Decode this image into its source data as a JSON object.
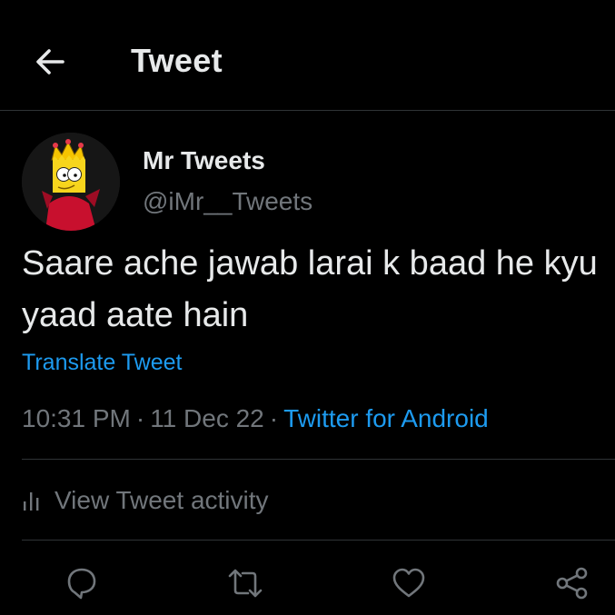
{
  "header": {
    "title": "Tweet",
    "back_icon": "arrow-left-icon"
  },
  "author": {
    "display_name": "Mr Tweets",
    "handle": "@iMr__Tweets",
    "avatar": "bart-simpson-avatar"
  },
  "tweet": {
    "text": "Saare ache jawab larai k baad he kyu yaad aate hain",
    "translate_label": "Translate Tweet",
    "time": "10:31 PM",
    "separator": "·",
    "date": "11 Dec 22",
    "source": "Twitter for Android"
  },
  "activity": {
    "label": "View Tweet activity",
    "icon": "bar-chart-icon"
  },
  "actions": {
    "reply_icon": "reply-icon",
    "retweet_icon": "retweet-icon",
    "like_icon": "heart-icon",
    "share_icon": "share-icon"
  },
  "colors": {
    "background": "#000000",
    "text": "#e7e9ea",
    "muted": "#71767b",
    "accent": "#1d9bf0",
    "divider": "#2f3336"
  }
}
